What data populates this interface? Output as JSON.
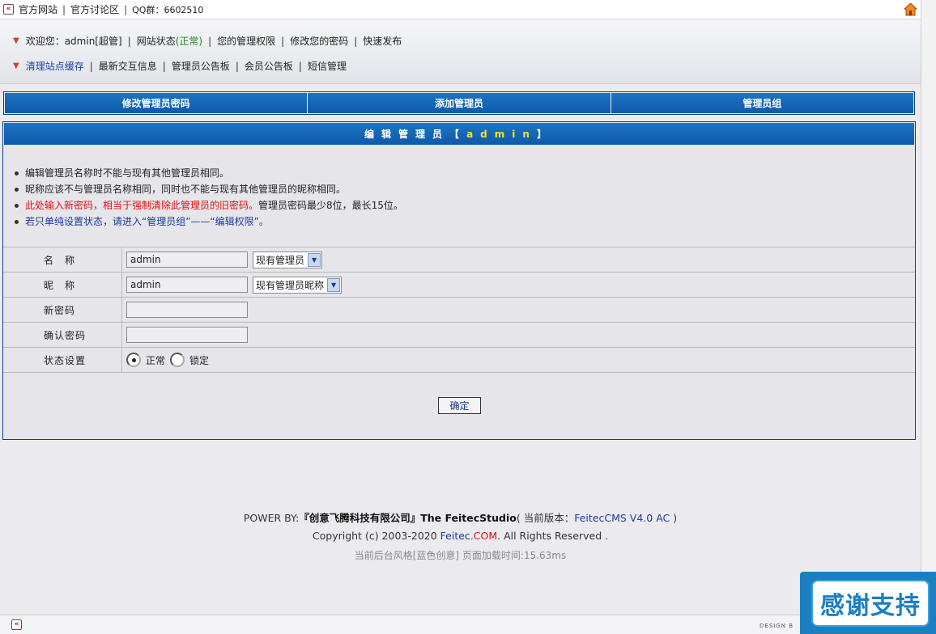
{
  "topbar": {
    "link_official_site": "官方网站",
    "link_forum": "官方讨论区",
    "qq_group": "QQ群：6602510"
  },
  "header": {
    "row1": {
      "welcome": "欢迎您：admin[超管]",
      "site_status_label": "网站状态",
      "site_status_value": "(正常)",
      "permissions": "您的管理权限",
      "change_password": "修改您的密码",
      "quick_publish": "快速发布"
    },
    "row2": {
      "clear_cache": "清理站点缓存",
      "latest_interaction": "最新交互信息",
      "admin_board": "管理员公告板",
      "member_board": "会员公告板",
      "sms_manage": "短信管理"
    }
  },
  "tabs": [
    "修改管理员密码",
    "添加管理员",
    "管理员组"
  ],
  "panel": {
    "title_prefix": "编辑管理员【",
    "title_user": "admin",
    "title_suffix": "】",
    "notes": {
      "n1": "编辑管理员名称时不能与现有其他管理员相同。",
      "n2": "昵称应该不与管理员名称相同，同时也不能与现有其他管理员的昵称相同。",
      "n3_red": "此处输入新密码，相当于强制清除此管理员的旧密码。",
      "n3_tail": "管理员密码最少8位，最长15位。",
      "n4": "若只单纯设置状态，请进入“管理员组”——“编辑权限”。"
    },
    "form": {
      "name_label": "名　称",
      "name_value": "admin",
      "name_select": "现有管理员",
      "nick_label": "昵　称",
      "nick_value": "admin",
      "nick_select": "现有管理员昵称",
      "newpw_label": "新密码",
      "confirm_label": "确认密码",
      "status_label": "状态设置",
      "status_options": [
        "正常",
        "锁定"
      ],
      "status_selected": "正常"
    },
    "submit": "确定"
  },
  "footer": {
    "powered_by": "POWER BY:",
    "company": "『创意飞腾科技有限公司』The FeitecStudio",
    "version_prefix": "( 当前版本：",
    "version": "FeitecCMS V4.0 AC",
    "version_suffix": " )",
    "copyright_prefix": "Copyright (c) 2003-2020 ",
    "brand": "Feitec",
    "brand_tld": ".COM",
    "copyright_suffix": ". All Rights Reserved .",
    "style_info": "当前后台风格[蓝色创意]  页面加载时间:15.63ms"
  },
  "bottombar": {
    "design_text": "DESIGN B"
  },
  "badge": {
    "text": "感谢支持"
  },
  "colors": {
    "accent_blue": "#0d5aa8",
    "title_highlight": "#ffde33",
    "warning_red": "#d11111"
  }
}
